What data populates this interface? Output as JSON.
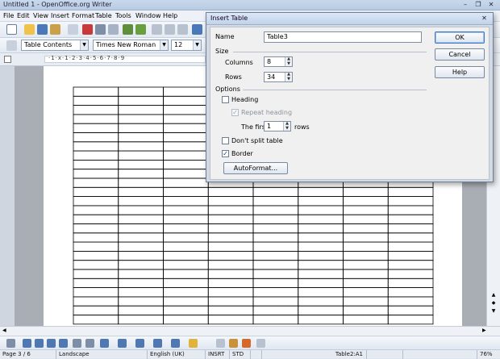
{
  "window": {
    "title": "Untitled 1 - OpenOffice.org Writer"
  },
  "menubar": {
    "items": [
      "File",
      "Edit",
      "View",
      "Insert",
      "Format",
      "Table",
      "Tools",
      "Window",
      "Help"
    ]
  },
  "formatting": {
    "paragraph_style": "Table Contents",
    "font_name": "Times New Roman",
    "font_size": "12"
  },
  "ruler": {
    "ticks": "·1·ⅹ·1·2·3·4·5·6·7·8·9"
  },
  "dialog": {
    "title": "Insert Table",
    "name_label": "Name",
    "name_value": "Table3",
    "size_label": "Size",
    "columns_label": "Columns",
    "columns_value": "8",
    "rows_label": "Rows",
    "rows_value": "34",
    "options_label": "Options",
    "heading_label": "Heading",
    "heading_checked": false,
    "repeat_heading_label": "Repeat heading",
    "repeat_heading_checked": true,
    "the_first_label": "The first",
    "the_first_value": "1",
    "rows_suffix": "rows",
    "dont_split_label": "Don't split table",
    "dont_split_checked": false,
    "border_label": "Border",
    "border_checked": true,
    "autoformat_label": "AutoFormat...",
    "ok_label": "OK",
    "cancel_label": "Cancel",
    "help_label": "Help"
  },
  "statusbar": {
    "page": "Page 3 / 6",
    "page_style": "Landscape",
    "language": "English (UK)",
    "insert_mode": "INSRT",
    "selection_mode": "STD",
    "cell": "Table2:A1",
    "zoom": "76%"
  }
}
